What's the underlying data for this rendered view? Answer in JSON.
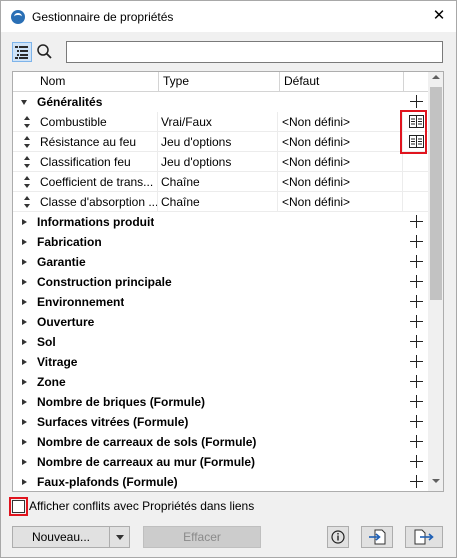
{
  "window": {
    "title": "Gestionnaire de propriétés",
    "close_label": "✕"
  },
  "search": {
    "value": "",
    "placeholder": ""
  },
  "columns": {
    "name": "Nom",
    "type": "Type",
    "default": "Défaut"
  },
  "expanded_group": {
    "label": "Généralités"
  },
  "items": [
    {
      "name": "Combustible",
      "type": "Vrai/Faux",
      "default": "<Non défini>",
      "has_doc_icon": true
    },
    {
      "name": "Résistance au feu",
      "type": "Jeu d'options",
      "default": "<Non défini>",
      "has_doc_icon": true
    },
    {
      "name": "Classification feu",
      "type": "Jeu d'options",
      "default": "<Non défini>",
      "has_doc_icon": false
    },
    {
      "name": "Coefficient de trans...",
      "type": "Chaîne",
      "default": "<Non défini>",
      "has_doc_icon": false
    },
    {
      "name": "Classe d'absorption ...",
      "type": "Chaîne",
      "default": "<Non défini>",
      "has_doc_icon": false
    }
  ],
  "groups": [
    "Informations produit",
    "Fabrication",
    "Garantie",
    "Construction principale",
    "Environnement",
    "Ouverture",
    "Sol",
    "Vitrage",
    "Zone",
    "Nombre de briques (Formule)",
    "Surfaces vitrées (Formule)",
    "Nombre de carreaux de sols (Formule)",
    "Nombre de carreaux au mur (Formule)",
    "Faux-plafonds (Formule)"
  ],
  "footer": {
    "checkbox_label": "Afficher conflits avec Propriétés dans liens",
    "checkbox_checked": false,
    "new_button": "Nouveau...",
    "delete_button": "Effacer"
  },
  "colors": {
    "highlight": "#e0141e",
    "selected_tool": "#cfe3f7"
  }
}
